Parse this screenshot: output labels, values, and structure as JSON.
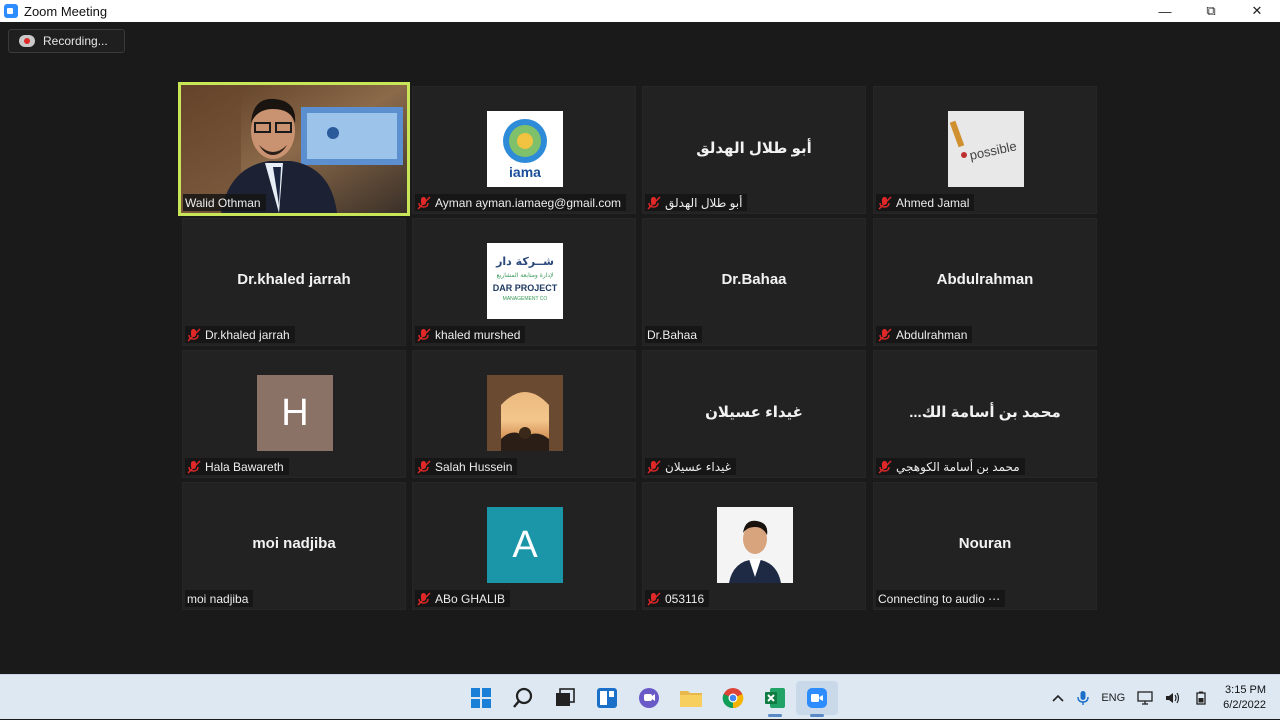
{
  "window": {
    "title": "Zoom Meeting",
    "minimize": "—",
    "maximize": "⧉",
    "close": "✕"
  },
  "recording": {
    "label": "Recording..."
  },
  "participants": [
    {
      "tag": "Walid Othman",
      "muted": false
    },
    {
      "tag": "Ayman ayman.iamaeg@gmail.com",
      "muted": true,
      "logo_text": "iama"
    },
    {
      "big": "أبو طلال الهدلق",
      "tag": "أبو طلال الهدلق",
      "muted": true
    },
    {
      "tag": "Ahmed Jamal",
      "muted": true,
      "image_text": "possible"
    },
    {
      "big": "Dr.khaled jarrah",
      "tag": "Dr.khaled jarrah",
      "muted": true
    },
    {
      "tag": "khaled murshed",
      "muted": true,
      "logo_arabic": "شــركة دار",
      "logo_arabic_sub": "لإدارة ومتابعة المشاريع",
      "logo_line1": "DAR PROJECT",
      "logo_line2": "MANAGEMENT CO"
    },
    {
      "big": "Dr.Bahaa",
      "tag": "Dr.Bahaa",
      "muted": false
    },
    {
      "big": "Abdulrahman",
      "tag": "Abdulrahman",
      "muted": true
    },
    {
      "initial": "H",
      "avatar_color": "#8a7266",
      "tag": "Hala Bawareth",
      "muted": true
    },
    {
      "tag": "Salah Hussein",
      "muted": true
    },
    {
      "big": "غيداء عسيلان",
      "tag": "غيداء عسيلان",
      "muted": true
    },
    {
      "big": "...محمد بن أسامة الك",
      "tag": "محمد بن أسامة الكوهجي",
      "muted": true
    },
    {
      "big": "moi nadjiba",
      "tag": "moi nadjiba",
      "muted": false
    },
    {
      "initial": "A",
      "avatar_color": "#1a96a8",
      "tag": "ABo GHALIB",
      "muted": true
    },
    {
      "tag": "053116",
      "muted": true
    },
    {
      "big": "Nouran",
      "tag": "Connecting to audio ⋯",
      "muted": false
    }
  ],
  "taskbar": {
    "apps": [
      "start-icon",
      "search-icon",
      "task-view-icon",
      "widgets-icon",
      "teams-chat-icon",
      "file-explorer-icon",
      "chrome-icon",
      "excel-icon",
      "zoom-icon"
    ],
    "language": "ENG",
    "time": "3:15 PM",
    "date": "6/2/2022"
  },
  "colors": {
    "active_speaker": "#c8e657",
    "mute_red": "#e02828",
    "zoom_blue": "#2d8cff"
  }
}
